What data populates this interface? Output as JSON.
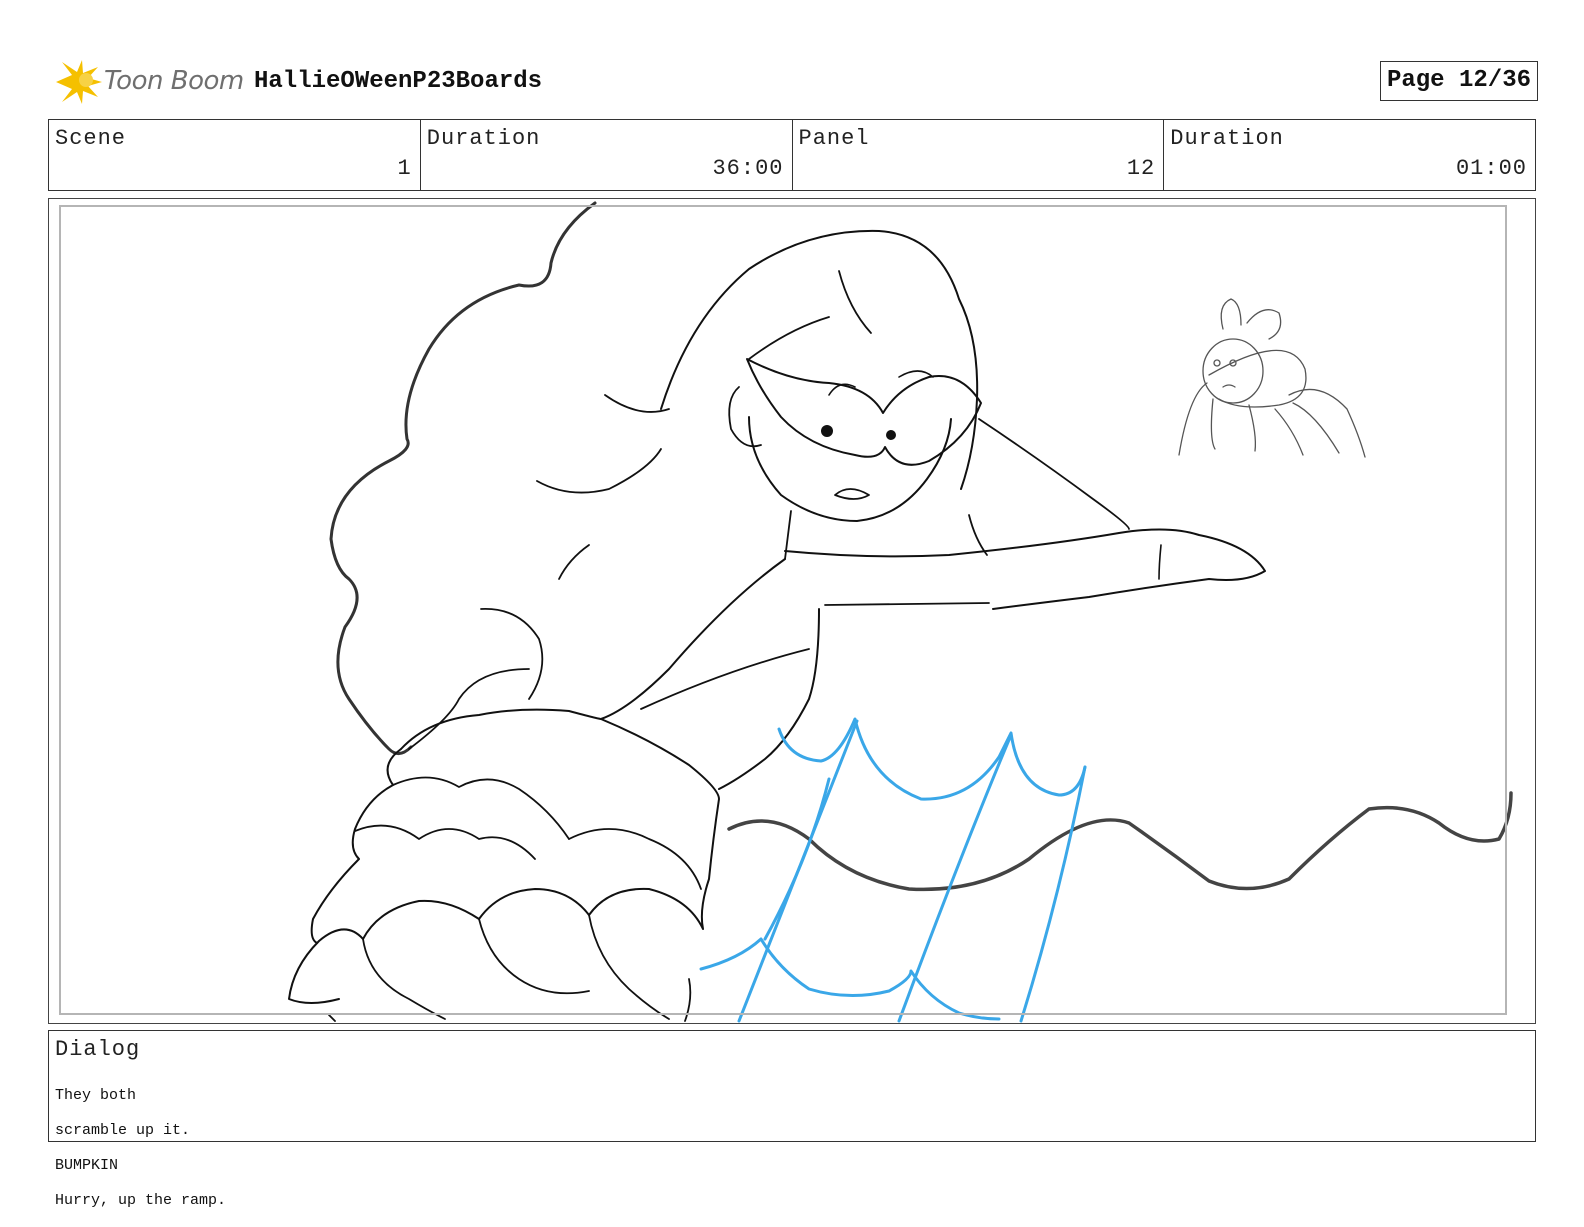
{
  "header": {
    "logo_text": "Toon Boom",
    "project_title": "HallieOWeenP23Boards",
    "page_label": "Page 12/36"
  },
  "info": {
    "scene": {
      "label": "Scene",
      "value": "1"
    },
    "scene_duration": {
      "label": "Duration",
      "value": "36:00"
    },
    "panel": {
      "label": "Panel",
      "value": "12"
    },
    "panel_duration": {
      "label": "Duration",
      "value": "01:00"
    }
  },
  "dialog": {
    "label": "Dialog",
    "lines": [
      "They both",
      "scramble up it.",
      "BUMPKIN",
      "Hurry, up the ramp."
    ]
  },
  "colors": {
    "logo_accent": "#f5c000",
    "water": "#3aa7e8",
    "line": "#111111",
    "ground": "#444444"
  }
}
